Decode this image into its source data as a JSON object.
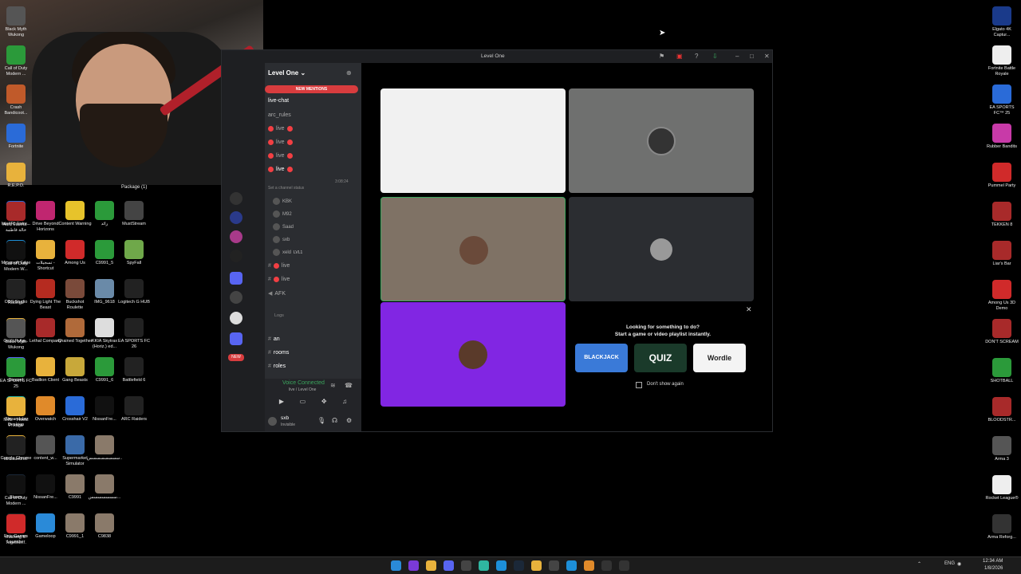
{
  "desktop_left": [
    {
      "label": "Intel(R) Extre...",
      "color": "#2a6bd8"
    },
    {
      "label": "Drive Beyond Horizons",
      "color": "#c02670"
    },
    {
      "label": "Content Warning",
      "color": "#e7c32b"
    },
    {
      "label": "رائد",
      "color": "#2b9a3a"
    },
    {
      "label": "MustStream",
      "color": "#444"
    },
    {
      "label": "Microsoft Edge",
      "color": "#1d8fd8"
    },
    {
      "label": "تسجيلات - Shortcut",
      "color": "#e8b23c"
    },
    {
      "label": "Among Us",
      "color": "#d02a2a"
    },
    {
      "label": "C9991_5",
      "color": "#2b9a3a"
    },
    {
      "label": "SpyFall",
      "color": "#6fa84a"
    },
    {
      "label": "OBS Studio",
      "color": "#333"
    },
    {
      "label": "Dying Light The Beast",
      "color": "#b52b20"
    },
    {
      "label": "Buckshot Roulette",
      "color": "#7a4a3a"
    },
    {
      "label": "IMG_9618",
      "color": "#6a8aa8"
    },
    {
      "label": "Logitech G HUB",
      "color": "#222"
    },
    {
      "label": "GoXLR-Ap...",
      "color": "#e8b23c"
    },
    {
      "label": "Lethal Company",
      "color": "#a82a2a"
    },
    {
      "label": "Chained Together",
      "color": "#b06a3a"
    },
    {
      "label": "KKIA Skytrax (Horiz.) ed...",
      "color": "#ddd"
    },
    {
      "label": "EA SPORTS FC 26",
      "color": "#222"
    },
    {
      "label": "Discord",
      "color": "#5865f2"
    },
    {
      "label": "Badlion Client",
      "color": "#e8b23c"
    },
    {
      "label": "Gang Beasts",
      "color": "#c8a83a"
    },
    {
      "label": "C9991_6",
      "color": "#2b9a3a"
    },
    {
      "label": "Battlefield 6",
      "color": "#222"
    },
    {
      "label": "Streamlabs Desktop",
      "color": "#2fb6a0"
    },
    {
      "label": "Overwatch",
      "color": "#e08a2a"
    },
    {
      "label": "Crosshair V2",
      "color": "#2a6bd8"
    },
    {
      "label": "NissanFre...",
      "color": "#111"
    },
    {
      "label": "ARC Raiders",
      "color": "#222"
    },
    {
      "label": "Google Chrome",
      "color": "#e8b23c"
    },
    {
      "label": "content_w...",
      "color": "#555"
    },
    {
      "label": "Supermarket Simulator",
      "color": "#3a6aa8"
    },
    {
      "label": "سسسسسسسس...",
      "color": "#8a7a6a"
    },
    {
      "label": "",
      "color": "#000"
    },
    {
      "label": "Steam",
      "color": "#1b2838"
    },
    {
      "label": "NissanFre...",
      "color": "#111"
    },
    {
      "label": "C9991",
      "color": "#8a7a6a"
    },
    {
      "label": "سسسسسسس...",
      "color": "#8a7a6a"
    },
    {
      "label": "",
      "color": "#000"
    },
    {
      "label": "Epic Games Launcher",
      "color": "#222"
    },
    {
      "label": "Gameloop",
      "color": "#2a8ad8"
    },
    {
      "label": "C9991_1",
      "color": "#8a7a6a"
    },
    {
      "label": "C9838",
      "color": "#8a7a6a"
    }
  ],
  "desktop_right": [
    {
      "label": "Black Myth Wukong",
      "color": "#555"
    },
    {
      "label": "Elgato 4K Captur...",
      "color": "#1a3a8a"
    },
    {
      "label": "Call of Duty Modern ...",
      "color": "#2b9a3a"
    },
    {
      "label": "Fortnite Battle Royale",
      "color": "#eee"
    },
    {
      "label": "Crash Bandicoot...",
      "color": "#c05a2a"
    },
    {
      "label": "EA SPORTS FC™ 25",
      "color": "#2a6bd8"
    },
    {
      "label": "Fortnite",
      "color": "#2a6bd8"
    },
    {
      "label": "Rubber Bandits",
      "color": "#c83aa8"
    },
    {
      "label": "R.E.P.O.",
      "color": "#e8b23c"
    },
    {
      "label": "Pummel Party",
      "color": "#d02a2a"
    },
    {
      "label": "Aunt Fatima - خالة فاطمة",
      "color": "#a82a2a"
    },
    {
      "label": "TEKKEN 8",
      "color": "#a82a2a"
    },
    {
      "label": "Call of Duty Modern W...",
      "color": "#111"
    },
    {
      "label": "Liar's Bar",
      "color": "#a82a2a"
    },
    {
      "label": "Rolling2",
      "color": "#222"
    },
    {
      "label": "Among Us 3D Demo",
      "color": "#d02a2a"
    },
    {
      "label": "Black Myth Wukong",
      "color": "#555"
    },
    {
      "label": "DON'T SCREAM",
      "color": "#a82a2a"
    },
    {
      "label": "EA SPORTS FC 25",
      "color": "#2b9a3a"
    },
    {
      "label": "SHOTBALL",
      "color": "#2b9a3a"
    },
    {
      "label": "NVE - FiveM P..kage",
      "color": "#e8b23c"
    },
    {
      "label": "BLOODSTR...",
      "color": "#a82a2a"
    },
    {
      "label": "sb Launcher",
      "color": "#222"
    },
    {
      "label": "Arma 3",
      "color": "#555"
    },
    {
      "label": "Call of Duty Modern ...",
      "color": "#111"
    },
    {
      "label": "Rocket League®",
      "color": "#eee"
    },
    {
      "label": "Pushing It! Together...",
      "color": "#d02a2a"
    },
    {
      "label": "Arma Reforg...",
      "color": "#333"
    }
  ],
  "package_label": "Package (1)",
  "window": {
    "title": "Level One",
    "server_name": "Level One",
    "new_mentions": "NEW MENTIONS",
    "channels": [
      {
        "name": "live-chat",
        "type": "text",
        "bright": true
      },
      {
        "name": "arc_rules",
        "type": "text",
        "bright": false
      },
      {
        "name": "live",
        "type": "voice",
        "bright": false
      },
      {
        "name": "live",
        "type": "voice",
        "bright": false
      },
      {
        "name": "live",
        "type": "voice",
        "bright": false
      },
      {
        "name": "live",
        "type": "voice",
        "bright": true
      }
    ],
    "channel_status": "Set a channel status",
    "call_timer": "3:08:24",
    "voice_users": [
      "KBK",
      "M92",
      "Saad",
      "sxb",
      "xeld"
    ],
    "badge": "LVL1",
    "channels2": [
      {
        "name": "live",
        "type": "voice"
      },
      {
        "name": "live",
        "type": "voice"
      },
      {
        "name": "AFK",
        "type": "voice"
      }
    ],
    "category": "Logs",
    "channels3": [
      "an",
      "rooms",
      "roles"
    ],
    "voice_connected": "Voice Connected",
    "voice_sub": "live / Level One",
    "user": "sxb",
    "user_status": "Invisible",
    "new_badge": "NEW",
    "activity": {
      "line1": "Looking for something to do?",
      "line2": "Start a game or video playlist instantly.",
      "games": [
        "BLACKJACK",
        "QUIZ",
        "Wordle"
      ],
      "dont_show": "Don't show again"
    }
  },
  "tray": {
    "lang": "ENG",
    "time": "12:34 AM",
    "date": "1/8/2026"
  }
}
